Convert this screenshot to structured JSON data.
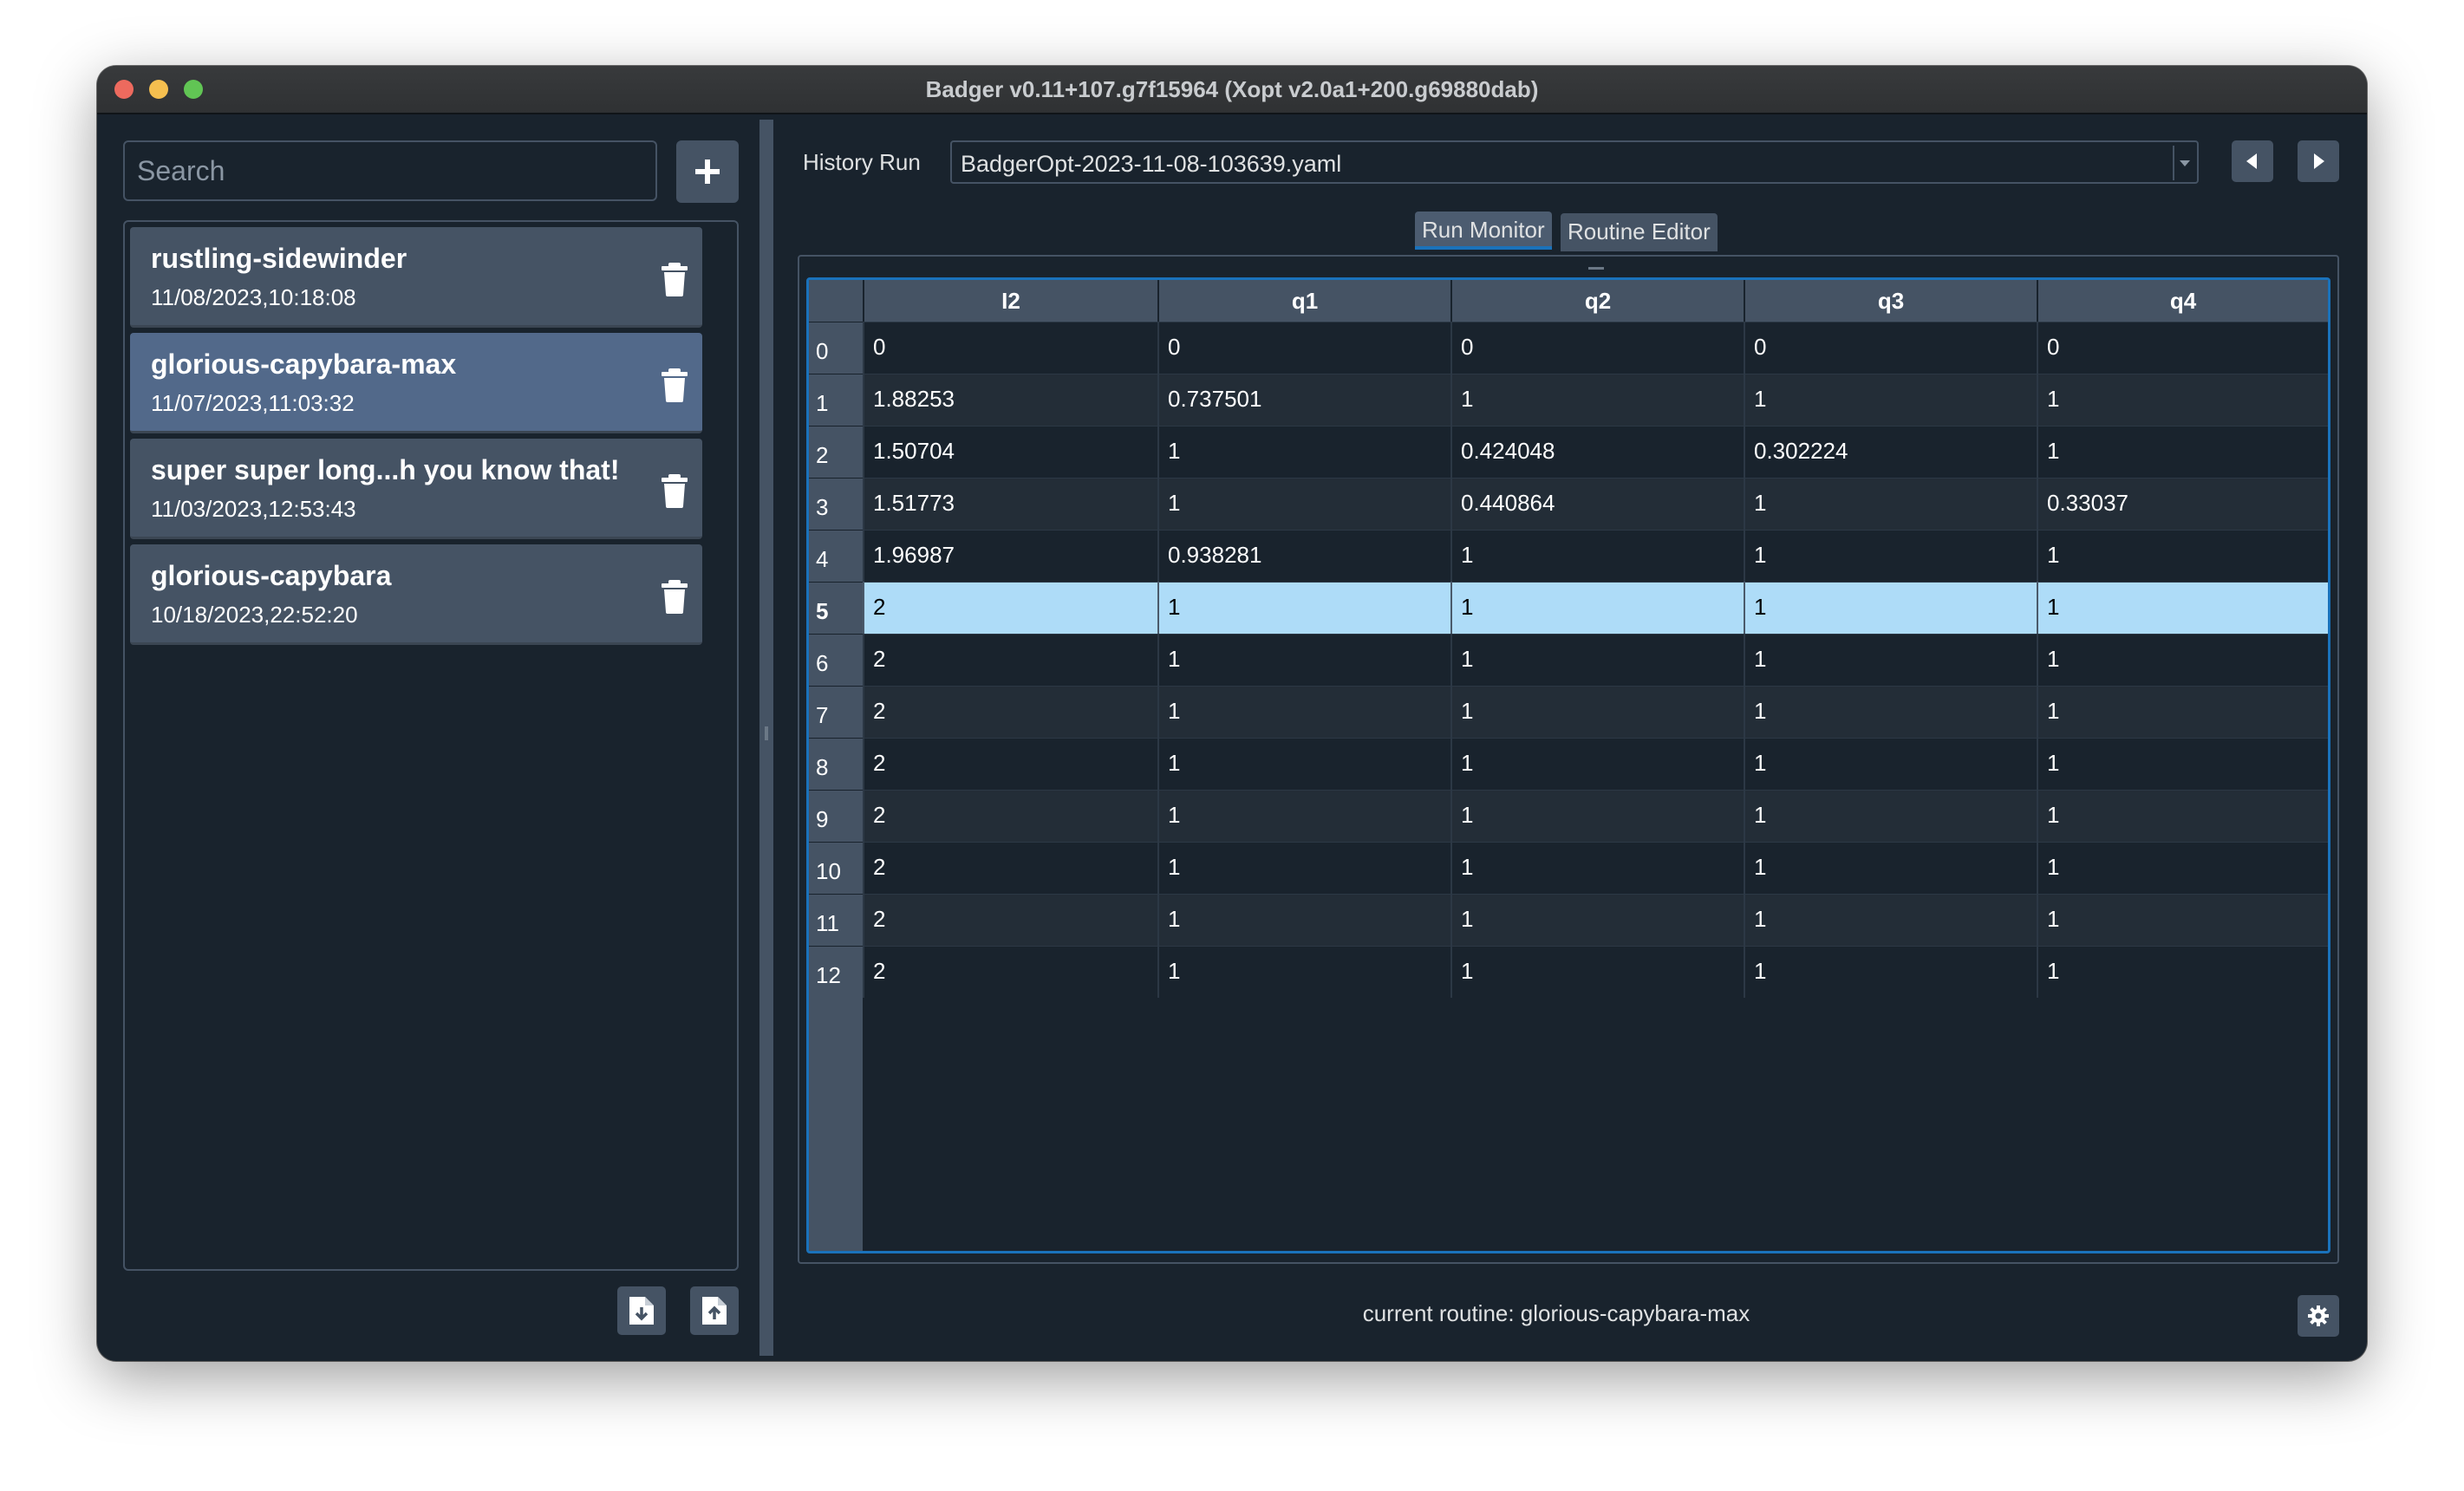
{
  "window": {
    "title": "Badger v0.11+107.g7f15964 (Xopt v2.0a1+200.g69880dab)"
  },
  "sidebar": {
    "search_placeholder": "Search",
    "add_icon": "plus-icon",
    "routines": [
      {
        "name": "rustling-sidewinder",
        "date": "11/08/2023,10:18:08",
        "selected": false
      },
      {
        "name": "glorious-capybara-max",
        "date": "11/07/2023,11:03:32",
        "selected": true
      },
      {
        "name": "super super long...h you know that!",
        "date": "11/03/2023,12:53:43",
        "selected": false
      },
      {
        "name": "glorious-capybara",
        "date": "10/18/2023,22:52:20",
        "selected": false
      }
    ],
    "import_icon": "file-import-icon",
    "export_icon": "file-export-icon"
  },
  "history": {
    "label": "History Run",
    "selected_file": "BadgerOpt-2023-11-08-103639.yaml"
  },
  "tabs": [
    {
      "label": "Run Monitor",
      "active": true
    },
    {
      "label": "Routine Editor",
      "active": false
    }
  ],
  "table": {
    "columns": [
      "I2",
      "q1",
      "q2",
      "q3",
      "q4"
    ],
    "selected_row": 5,
    "rows": [
      {
        "index": "0",
        "cells": [
          "0",
          "0",
          "0",
          "0",
          "0"
        ]
      },
      {
        "index": "1",
        "cells": [
          "1.88253",
          "0.737501",
          "1",
          "1",
          "1"
        ]
      },
      {
        "index": "2",
        "cells": [
          "1.50704",
          "1",
          "0.424048",
          "0.302224",
          "1"
        ]
      },
      {
        "index": "3",
        "cells": [
          "1.51773",
          "1",
          "0.440864",
          "1",
          "0.33037"
        ]
      },
      {
        "index": "4",
        "cells": [
          "1.96987",
          "0.938281",
          "1",
          "1",
          "1"
        ]
      },
      {
        "index": "5",
        "cells": [
          "2",
          "1",
          "1",
          "1",
          "1"
        ]
      },
      {
        "index": "6",
        "cells": [
          "2",
          "1",
          "1",
          "1",
          "1"
        ]
      },
      {
        "index": "7",
        "cells": [
          "2",
          "1",
          "1",
          "1",
          "1"
        ]
      },
      {
        "index": "8",
        "cells": [
          "2",
          "1",
          "1",
          "1",
          "1"
        ]
      },
      {
        "index": "9",
        "cells": [
          "2",
          "1",
          "1",
          "1",
          "1"
        ]
      },
      {
        "index": "10",
        "cells": [
          "2",
          "1",
          "1",
          "1",
          "1"
        ]
      },
      {
        "index": "11",
        "cells": [
          "2",
          "1",
          "1",
          "1",
          "1"
        ]
      },
      {
        "index": "12",
        "cells": [
          "2",
          "1",
          "1",
          "1",
          "1"
        ]
      }
    ]
  },
  "status": {
    "text": "current routine: glorious-capybara-max"
  },
  "colors": {
    "background": "#19232d",
    "panel": "#455364",
    "accent": "#1a72bb",
    "selected_item": "#52698a",
    "selected_row": "#aedcf8"
  }
}
